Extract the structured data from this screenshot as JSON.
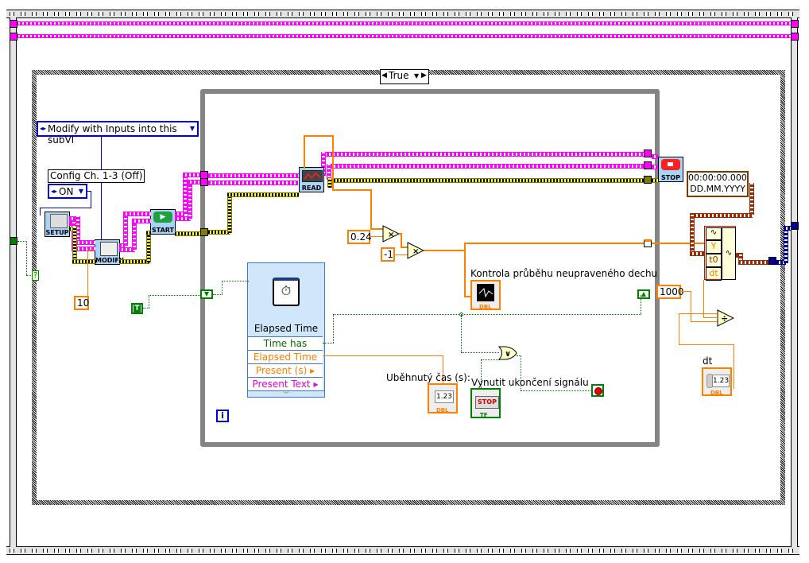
{
  "window": {
    "kind": "LabVIEW block diagram"
  },
  "case_structure": {
    "selector_value": "True"
  },
  "constants": {
    "ring_modify": "Modify with Inputs into this subVI",
    "config_label": "Config Ch. 1-3 (Off)",
    "config_value": "ON",
    "num_10": "10",
    "num_024": "0.24",
    "num_neg1": "-1",
    "num_1000": "1000",
    "bool_true": "T",
    "timestamp_line1": "00:00:00.000",
    "timestamp_line2": "DD.MM.YYYY"
  },
  "subvis": {
    "setup": "SETUP",
    "modify": "MODIFY",
    "start": "START",
    "read": "READ",
    "stop": "STOP"
  },
  "express_vi": {
    "title": "Elapsed Time",
    "outputs": [
      {
        "label": "Time has Elapse",
        "color": "#007000"
      },
      {
        "label": "Elapsed Time (s)",
        "color": "#ff8000"
      },
      {
        "label": "Present (s)",
        "color": "#ff8000"
      },
      {
        "label": "Present Text",
        "color": "#e000e0"
      }
    ]
  },
  "indicators": {
    "chart_label": "Kontrola průběhu neupraveného dechu",
    "elapsed_label": "Uběhnutý čas (s):",
    "elapsed_value": "1.23",
    "stop_label": "Vynutit ukončení signálu",
    "stop_button_text": "STOP",
    "dt_label": "dt",
    "dt_value": "1.23",
    "type_dbl": "DBL",
    "type_tf": "TF"
  },
  "build_waveform": {
    "inputs": [
      "Y",
      "t0",
      "dt"
    ]
  },
  "iteration_terminal": "i",
  "selector_terminal": "?"
}
